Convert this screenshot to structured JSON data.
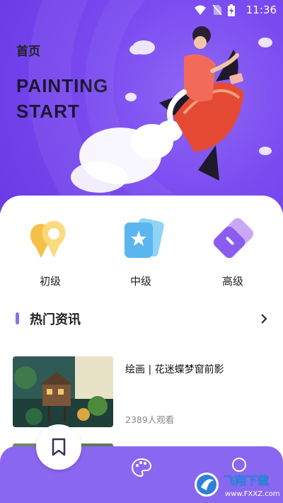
{
  "status_bar": {
    "time": "11:36"
  },
  "header": {
    "title": "首页",
    "banner_line1": "PAINTING",
    "banner_line2": "START"
  },
  "levels": [
    {
      "label": "初级",
      "icon": "location-pin-icon"
    },
    {
      "label": "中级",
      "icon": "star-card-icon"
    },
    {
      "label": "高级",
      "icon": "layers-icon"
    }
  ],
  "section": {
    "title": "热门资讯"
  },
  "news": [
    {
      "title": "绘画 | 花迷蝶梦窗前影",
      "views": "2389人观看"
    }
  ],
  "tabbar": {
    "items": [
      "home",
      "palette",
      "profile"
    ]
  },
  "watermark": {
    "text": "飞翔下载",
    "url": "www.FXXZ.com"
  },
  "colors": {
    "accent": "#8a67f1",
    "banner": "#7a4bf0"
  }
}
